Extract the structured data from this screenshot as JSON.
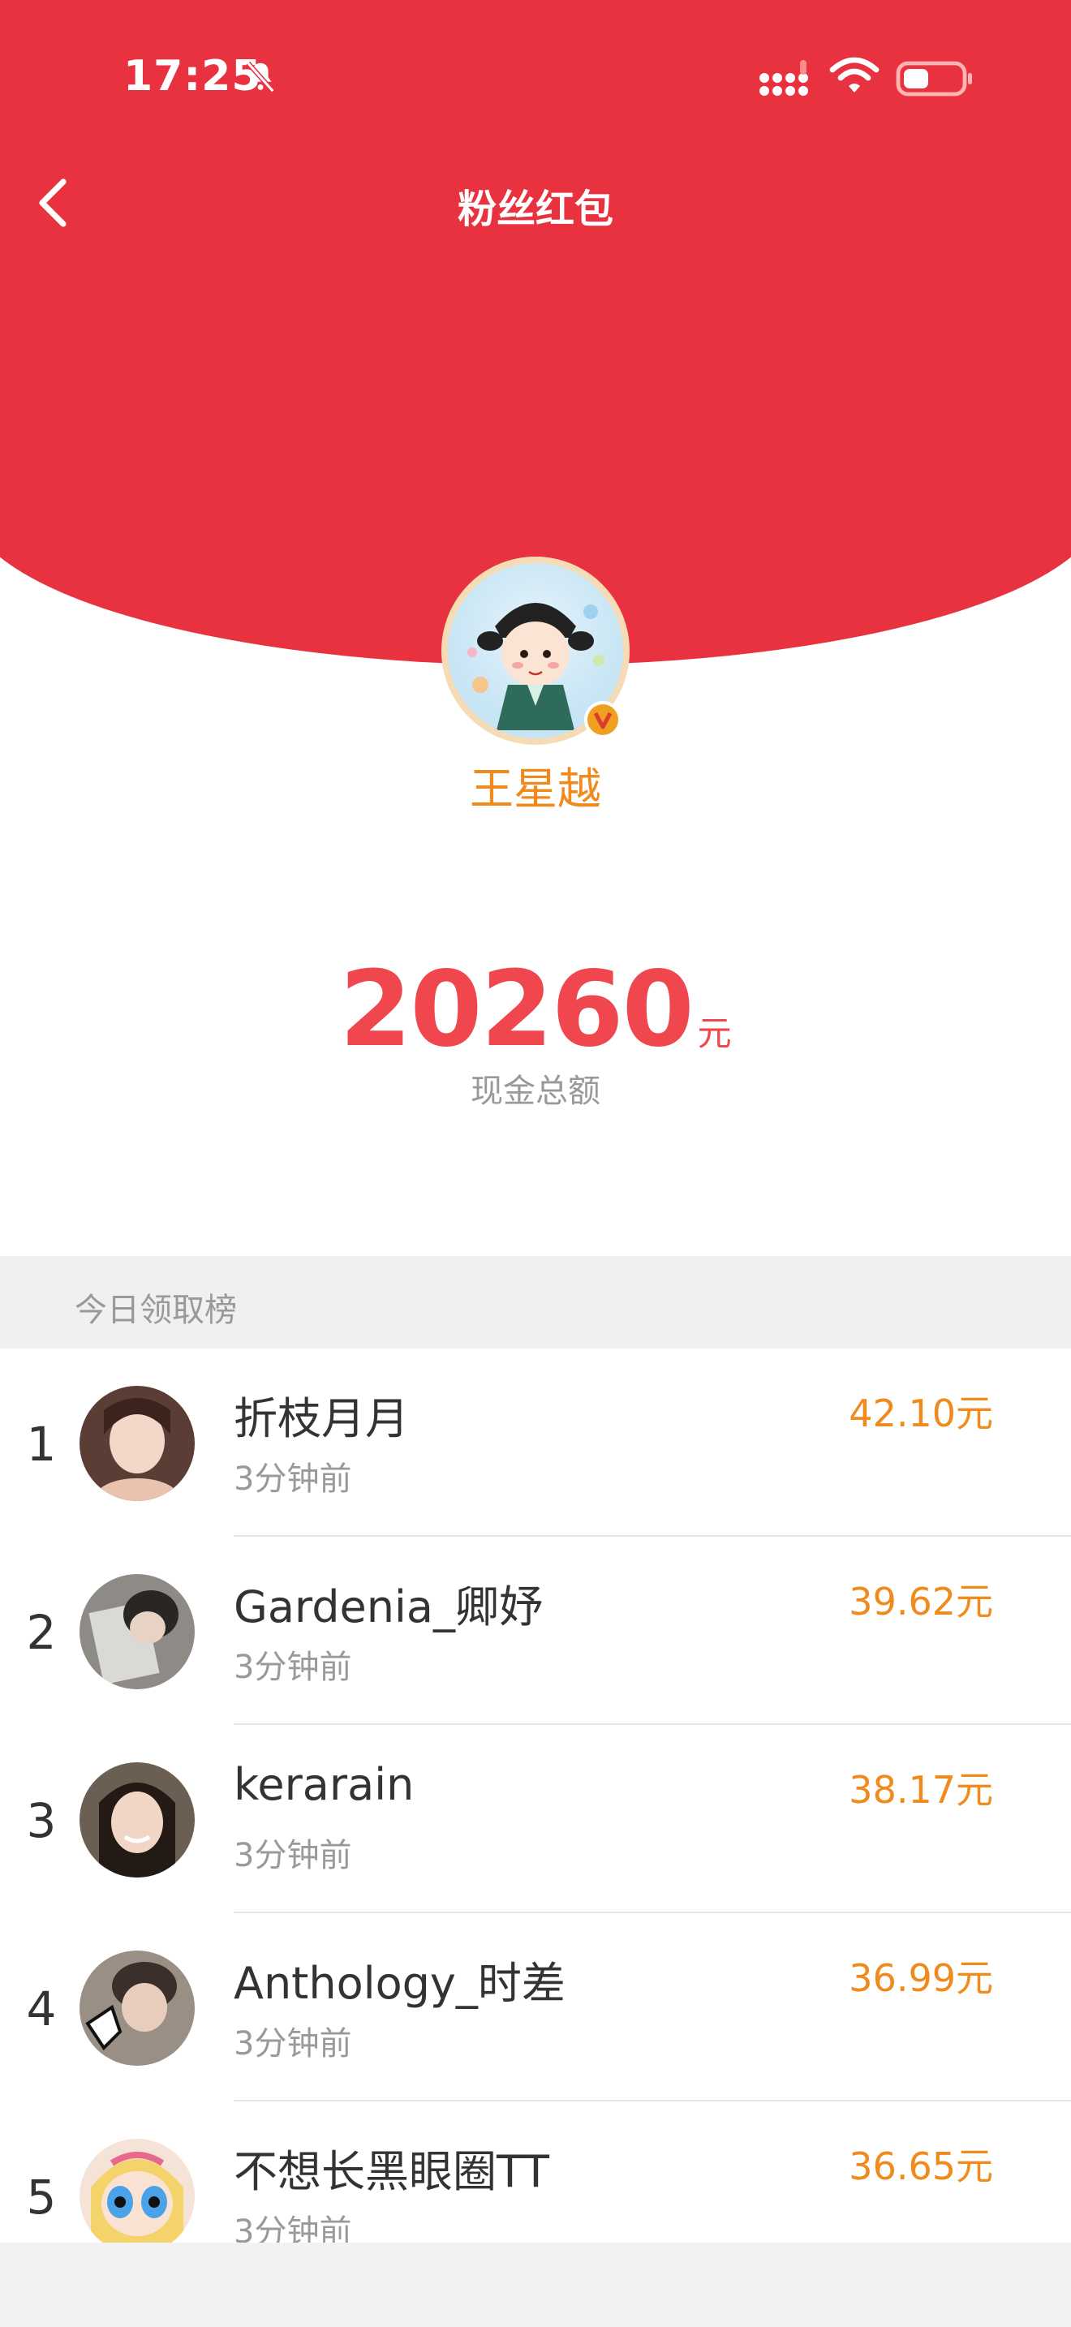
{
  "status_bar": {
    "time": "17:25"
  },
  "nav": {
    "title": "粉丝红包"
  },
  "star": {
    "name": "王星越"
  },
  "summary": {
    "amount": "20260",
    "unit": "元",
    "label": "现金总额"
  },
  "ranking": {
    "title": "今日领取榜",
    "items": [
      {
        "rank": "1",
        "name": "折枝月月",
        "time": "3分钟前",
        "amount": "42.10元"
      },
      {
        "rank": "2",
        "name": "Gardenia_卿妤",
        "time": "3分钟前",
        "amount": "39.62元"
      },
      {
        "rank": "3",
        "name": "kerarain",
        "time": "3分钟前",
        "amount": "38.17元"
      },
      {
        "rank": "4",
        "name": "Anthology_时差",
        "time": "3分钟前",
        "amount": "36.99元"
      },
      {
        "rank": "5",
        "name": "不想长黑眼圈TT",
        "time": "3分钟前",
        "amount": "36.65元"
      }
    ]
  },
  "colors": {
    "header_red": "#e8323f",
    "amount_red": "#f0464d",
    "orange": "#f08a1d"
  },
  "icons": [
    "bell-muted-icon",
    "signal-icon",
    "wifi-icon",
    "battery-icon",
    "back-chevron-icon",
    "verified-badge-icon"
  ]
}
